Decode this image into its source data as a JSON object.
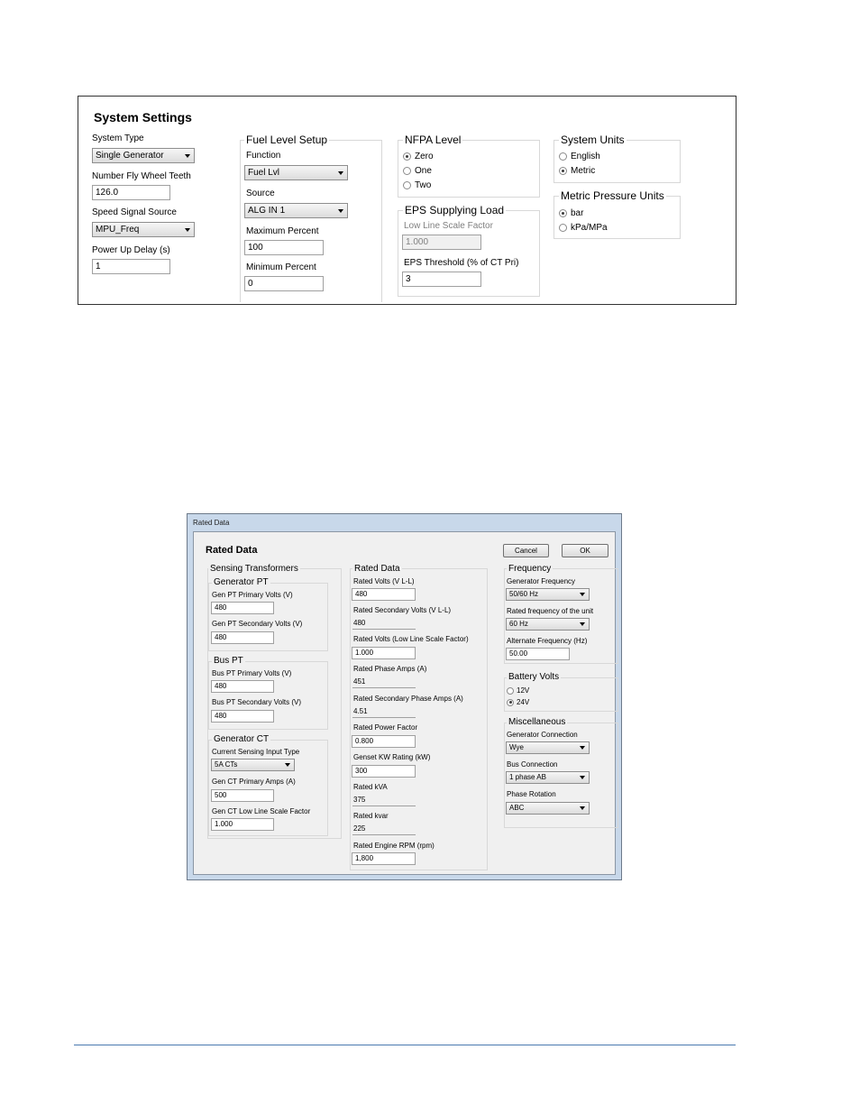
{
  "system_settings": {
    "title": "System Settings",
    "system_type": {
      "label": "System Type",
      "value": "Single Generator"
    },
    "fly_wheel": {
      "label": "Number Fly Wheel Teeth",
      "value": "126.0"
    },
    "speed_source": {
      "label": "Speed Signal Source",
      "value": "MPU_Freq"
    },
    "power_up": {
      "label": "Power Up Delay (s)",
      "value": "1"
    },
    "fuel": {
      "title": "Fuel Level Setup",
      "function_label": "Function",
      "function_value": "Fuel Lvl",
      "source_label": "Source",
      "source_value": "ALG IN 1",
      "max_label": "Maximum Percent",
      "max_value": "100",
      "min_label": "Minimum Percent",
      "min_value": "0"
    },
    "nfpa": {
      "title": "NFPA Level",
      "options": [
        "Zero",
        "One",
        "Two"
      ],
      "selected": 0
    },
    "eps": {
      "title": "EPS Supplying Load",
      "scale_label": "Low Line Scale Factor",
      "scale_value": "1.000",
      "threshold_label": "EPS Threshold (% of CT Pri)",
      "threshold_value": "3"
    },
    "units": {
      "title": "System Units",
      "options": [
        "English",
        "Metric"
      ],
      "selected": 1
    },
    "pressure": {
      "title": "Metric Pressure Units",
      "options": [
        "bar",
        "kPa/MPa"
      ],
      "selected": 0
    }
  },
  "rated_data": {
    "window_title": "Rated Data",
    "title": "Rated Data",
    "cancel": "Cancel",
    "ok": "OK",
    "sensing": {
      "title": "Sensing Transformers",
      "gen_pt": {
        "title": "Generator PT",
        "primary_label": "Gen PT Primary Volts (V)",
        "primary_value": "480",
        "secondary_label": "Gen PT Secondary Volts (V)",
        "secondary_value": "480"
      },
      "bus_pt": {
        "title": "Bus PT",
        "primary_label": "Bus PT Primary Volts (V)",
        "primary_value": "480",
        "secondary_label": "Bus PT Secondary Volts (V)",
        "secondary_value": "480"
      },
      "gen_ct": {
        "title": "Generator CT",
        "input_label": "Current Sensing Input Type",
        "input_value": "5A CTs",
        "primary_label": "Gen CT Primary Amps (A)",
        "primary_value": "500",
        "scale_label": "Gen CT Low Line Scale Factor",
        "scale_value": "1.000"
      }
    },
    "rated": {
      "title": "Rated Data",
      "fields": [
        {
          "label": "Rated Volts (V L-L)",
          "value": "480",
          "editable": true
        },
        {
          "label": "Rated Secondary Volts (V L-L)",
          "value": "480",
          "editable": false
        },
        {
          "label": "Rated Volts (Low Line Scale Factor)",
          "value": "1.000",
          "editable": true
        },
        {
          "label": "Rated Phase Amps (A)",
          "value": "451",
          "editable": false
        },
        {
          "label": "Rated Secondary Phase Amps (A)",
          "value": "4.51",
          "editable": false
        },
        {
          "label": "Rated Power Factor",
          "value": "0.800",
          "editable": true
        },
        {
          "label": "Genset KW Rating (kW)",
          "value": "300",
          "editable": true
        },
        {
          "label": "Rated kVA",
          "value": "375",
          "editable": false
        },
        {
          "label": "Rated kvar",
          "value": "225",
          "editable": false
        },
        {
          "label": "Rated Engine RPM (rpm)",
          "value": "1,800",
          "editable": true
        }
      ]
    },
    "frequency": {
      "title": "Frequency",
      "gen_freq_label": "Generator Frequency",
      "gen_freq_value": "50/60 Hz",
      "rated_freq_label": "Rated frequency of the unit",
      "rated_freq_value": "60 Hz",
      "alt_freq_label": "Alternate Frequency (Hz)",
      "alt_freq_value": "50.00"
    },
    "battery": {
      "title": "Battery Volts",
      "options": [
        "12V",
        "24V"
      ],
      "selected": 1
    },
    "misc": {
      "title": "Miscellaneous",
      "gen_conn_label": "Generator Connection",
      "gen_conn_value": "Wye",
      "bus_conn_label": "Bus Connection",
      "bus_conn_value": "1 phase AB",
      "phase_label": "Phase Rotation",
      "phase_value": "ABC"
    }
  }
}
